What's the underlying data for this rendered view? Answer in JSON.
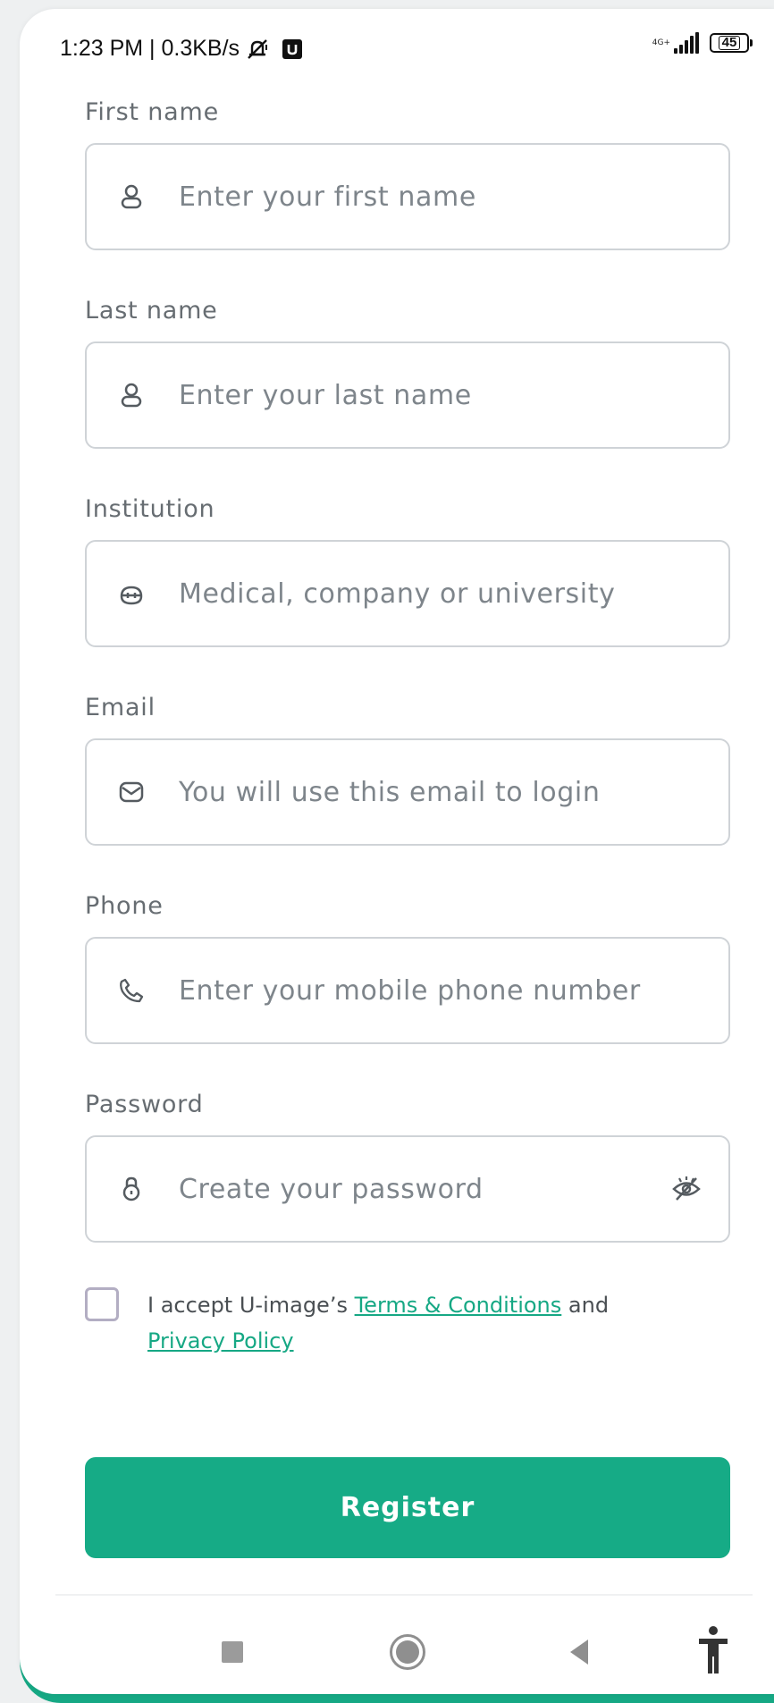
{
  "status_bar": {
    "time_and_speed": "1:23 PM | 0.3KB/s",
    "network_type": "4G+",
    "battery_level": "45",
    "icons": [
      "mute-bell-icon",
      "u-app-icon",
      "signal-icon",
      "battery-icon"
    ]
  },
  "form": {
    "first_name": {
      "label": "First name",
      "placeholder": "Enter your first name",
      "icon": "user-icon"
    },
    "last_name": {
      "label": "Last name",
      "placeholder": "Enter your last name",
      "icon": "user-icon"
    },
    "institution": {
      "label": "Institution",
      "placeholder": "Medical, company or university",
      "icon": "briefcase-icon"
    },
    "email": {
      "label": "Email",
      "placeholder": "You will use this email to login",
      "icon": "mail-icon"
    },
    "phone": {
      "label": "Phone",
      "placeholder": "Enter your mobile phone number",
      "icon": "phone-icon"
    },
    "password": {
      "label": "Password",
      "placeholder": "Create your password",
      "icon": "lock-icon",
      "toggle_icon": "eye-off-icon"
    }
  },
  "consent": {
    "prefix": "I accept U-image’s ",
    "terms_link": "Terms & Conditions",
    "middle": " and",
    "privacy_link": "Privacy Policy",
    "checked": false
  },
  "register_label": "Register",
  "nav_bar": {
    "icons": [
      "recent-apps-icon",
      "home-icon",
      "back-icon",
      "accessibility-icon"
    ]
  },
  "colors": {
    "accent": "#16ab86",
    "label_text": "#676d72",
    "placeholder_text": "#7e858b",
    "field_border": "#cfd3d7"
  }
}
